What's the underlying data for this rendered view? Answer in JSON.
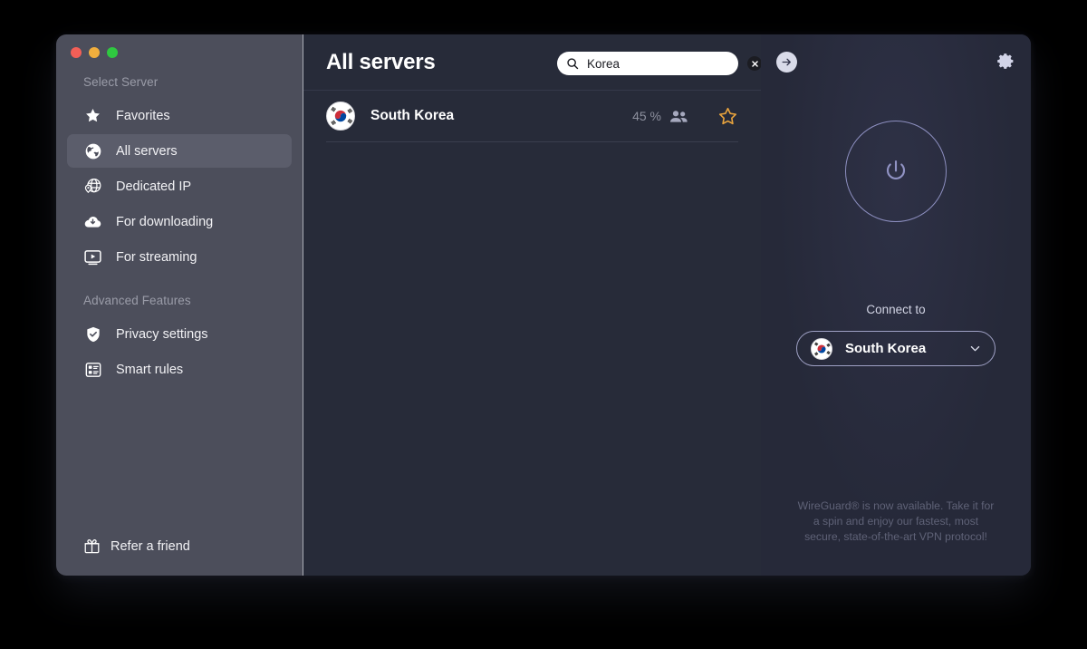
{
  "window": {
    "traffic_lights": [
      {
        "name": "close",
        "color": "#f35f57"
      },
      {
        "name": "minimize",
        "color": "#f0ae3d"
      },
      {
        "name": "maximize",
        "color": "#2fc840"
      }
    ]
  },
  "sidebar": {
    "section_select_server": "Select Server",
    "section_advanced": "Advanced Features",
    "items": [
      {
        "label": "Favorites",
        "icon": "star-icon",
        "selected": false
      },
      {
        "label": "All servers",
        "icon": "globe-icon",
        "selected": true
      },
      {
        "label": "Dedicated IP",
        "icon": "globe-pin-icon",
        "selected": false
      },
      {
        "label": "For downloading",
        "icon": "cloud-download-icon",
        "selected": false
      },
      {
        "label": "For streaming",
        "icon": "play-screen-icon",
        "selected": false
      }
    ],
    "advanced_items": [
      {
        "label": "Privacy settings",
        "icon": "shield-check-icon",
        "selected": false
      },
      {
        "label": "Smart rules",
        "icon": "rules-list-icon",
        "selected": false
      }
    ],
    "refer_a_friend": "Refer a friend"
  },
  "main": {
    "title": "All servers",
    "search": {
      "value": "Korea",
      "placeholder": "Search",
      "icon": "search-icon",
      "clear_icon": "clear-circle-icon"
    },
    "servers": [
      {
        "name": "South Korea",
        "flag": "flag-south-korea",
        "load": "45 %",
        "users_icon": "people-icon",
        "favorite": false,
        "favorite_icon": "star-outline-icon"
      }
    ]
  },
  "right_panel": {
    "back_icon": "arrow-right-circle-icon",
    "settings_icon": "gear-icon",
    "power_icon": "power-icon",
    "connect_to_label": "Connect to",
    "selected_country": "South Korea",
    "selected_country_flag": "flag-south-korea",
    "dropdown_icon": "chevron-down-icon",
    "promo_text": "WireGuard® is now available. Take it for a spin and enjoy our fastest, most secure, state-of-the-art VPN protocol!"
  },
  "colors": {
    "sidebar_bg": "#4c4e5b",
    "main_bg": "#272b39",
    "right_bg": "#272a3a",
    "accent_ring": "#8d8fc0",
    "star_gold": "#e8a33d"
  }
}
